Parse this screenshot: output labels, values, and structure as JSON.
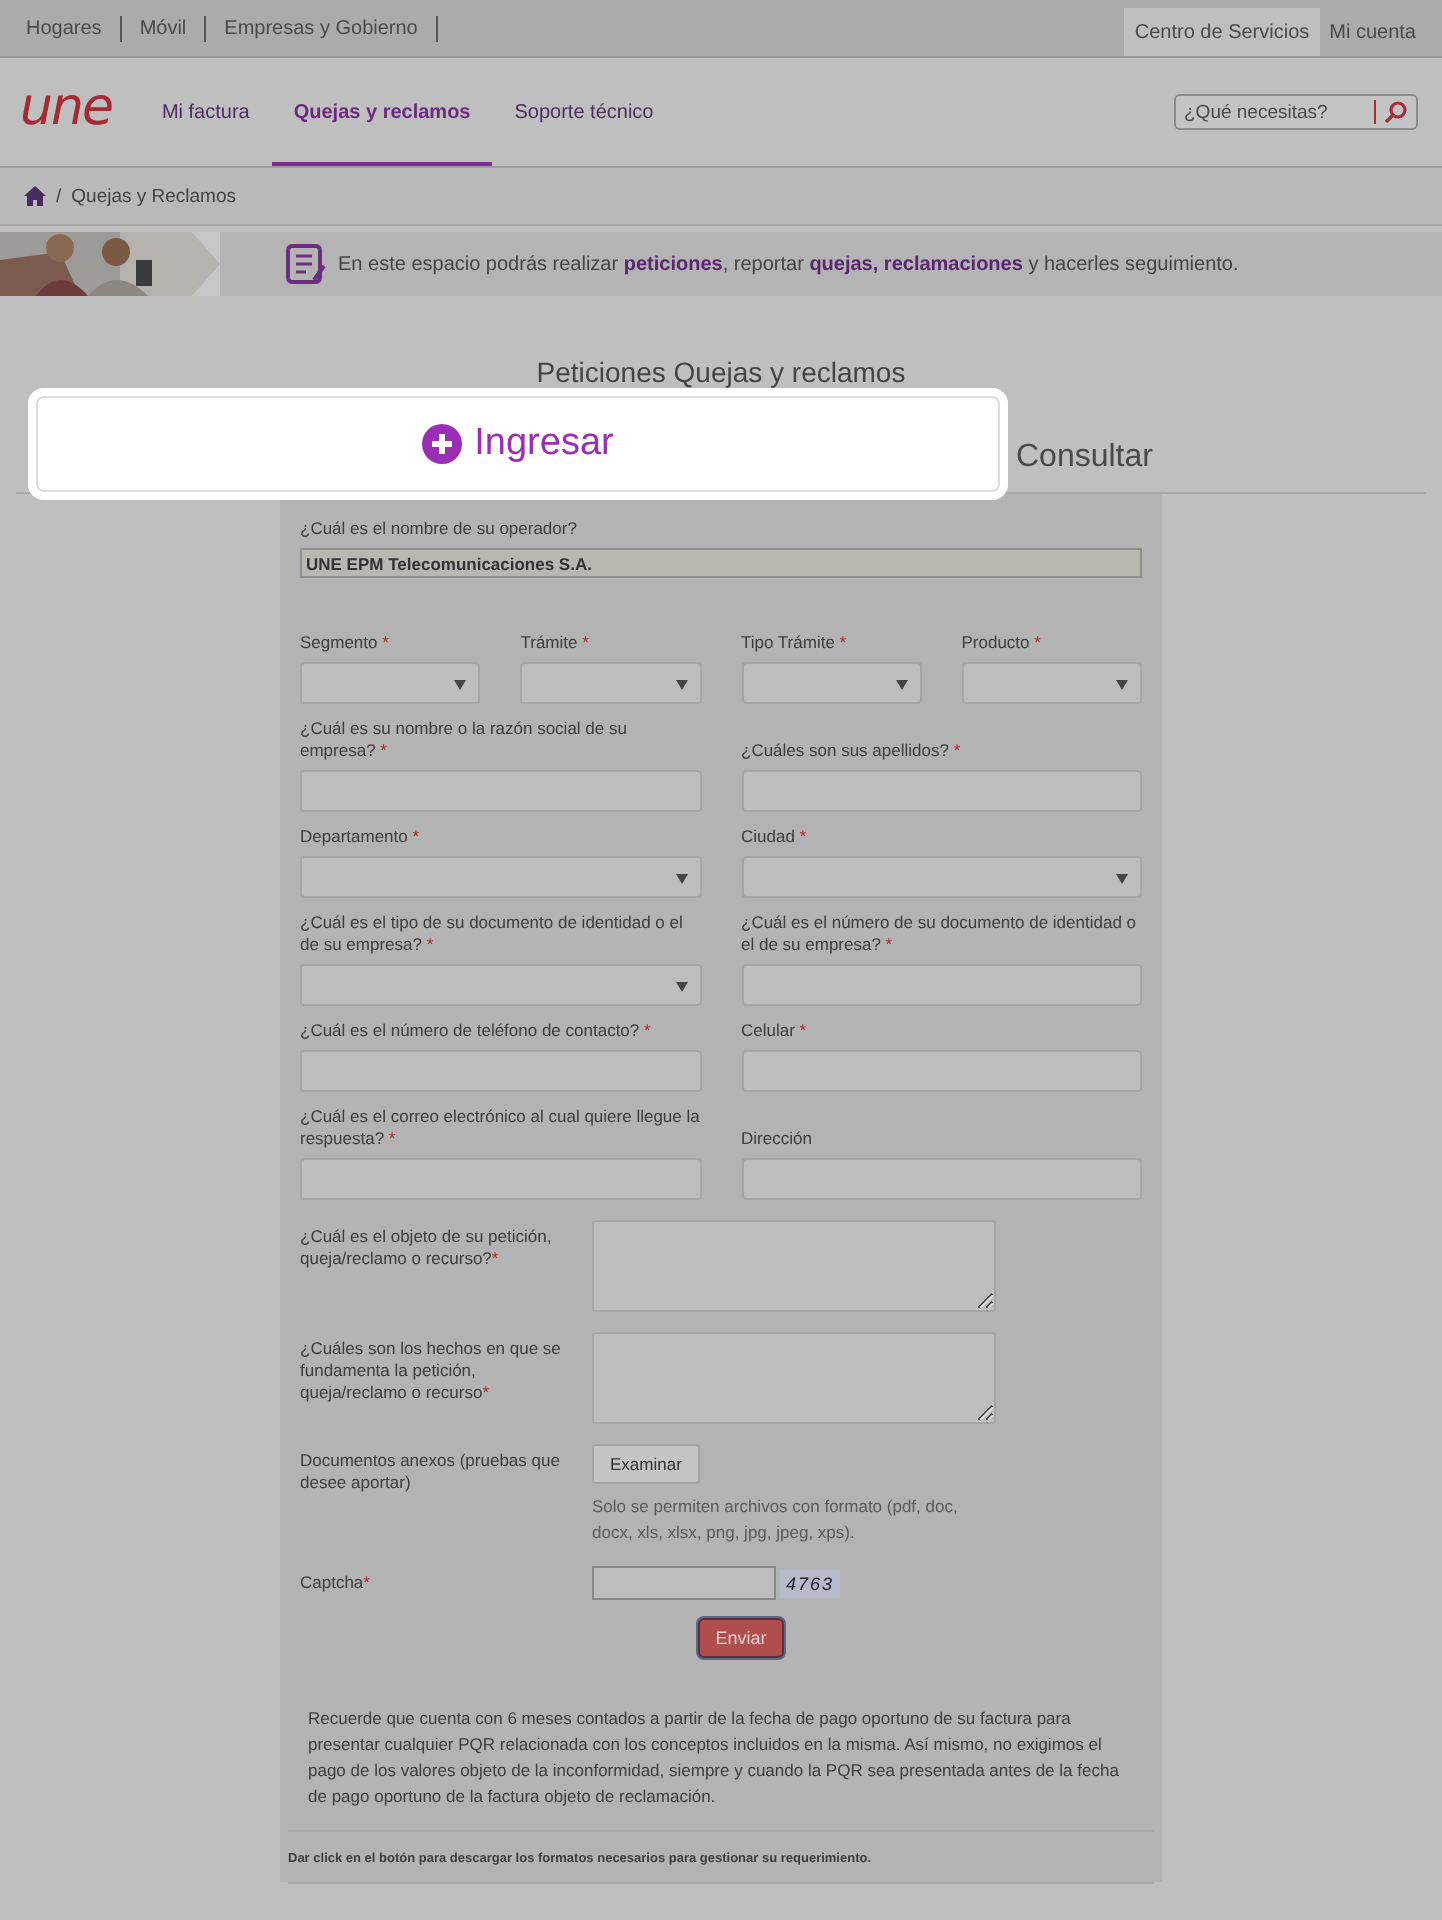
{
  "top_bar": {
    "links": [
      {
        "label": "Hogares"
      },
      {
        "label": "Móvil"
      },
      {
        "label": "Empresas y Gobierno"
      }
    ],
    "tabs": [
      {
        "label": "Centro de Servicios",
        "selected": true
      },
      {
        "label": "Mi cuenta",
        "selected": false
      }
    ]
  },
  "header": {
    "logo": "une",
    "nav": [
      {
        "label": "Mi factura",
        "selected": false
      },
      {
        "label": "Quejas y reclamos",
        "selected": true
      },
      {
        "label": "Soporte técnico",
        "selected": false
      }
    ],
    "search": {
      "placeholder": "¿Qué necesitas?"
    }
  },
  "breadcrumb": {
    "separator": "/",
    "current": "Quejas y Reclamos"
  },
  "banner": {
    "text": "En este espacio podrás realizar **peticiones**, reportar **quejas, reclamaciones** y hacerles seguimiento."
  },
  "page_title": "Peticiones Quejas y reclamos",
  "tabs": [
    {
      "label": "Ingresar",
      "selected": true
    },
    {
      "label": "Consultar",
      "selected": false
    }
  ],
  "form": {
    "operator": {
      "label": "¿Cuál es el nombre de su operador?",
      "value": "UNE EPM Telecomunicaciones S.A."
    },
    "selects": [
      {
        "label": "Segmento",
        "required_mark": "*"
      },
      {
        "label": "Trámite",
        "required_mark": "*"
      },
      {
        "label": "Tipo Trámite",
        "required_mark": "*"
      },
      {
        "label": "Producto",
        "required_mark": "*"
      }
    ],
    "fields": [
      {
        "label": "¿Cuál es su nombre o la razón social de su empresa?",
        "required_mark": "*",
        "kind": "text"
      },
      {
        "label": "¿Cuáles son sus apellidos?",
        "required_mark": "*",
        "kind": "text"
      },
      {
        "label": "Departamento",
        "required_mark": "*",
        "kind": "select"
      },
      {
        "label": "Ciudad",
        "required_mark": "*",
        "kind": "select"
      },
      {
        "label": "¿Cuál es el tipo de su documento de identidad o el de su empresa?",
        "required_mark": "*",
        "kind": "select"
      },
      {
        "label": "¿Cuál es el número de su documento de identidad o el de su empresa?",
        "required_mark": "*",
        "kind": "text"
      },
      {
        "label": "¿Cuál es el número de teléfono de contacto?",
        "required_mark": "*",
        "kind": "text"
      },
      {
        "label": "Celular",
        "required_mark": "*",
        "kind": "text"
      },
      {
        "label": "¿Cuál es el correo electrónico al cual quiere llegue la respuesta?",
        "required_mark": "*",
        "kind": "text"
      },
      {
        "label": "Dirección",
        "kind": "text"
      }
    ],
    "side_rows": [
      {
        "label": "¿Cuál es el objeto de su petición, queja/reclamo o recurso?",
        "required_mark": "*",
        "kind": "textarea"
      },
      {
        "label": "¿Cuáles son los hechos en que se fundamenta la petición, queja/reclamo o recurso",
        "required_mark": "*",
        "kind": "textarea"
      },
      {
        "label": "Documentos anexos (pruebas que desee aportar)",
        "kind": "file",
        "button": "Examinar",
        "note": "Solo se permiten archivos con formato (pdf, doc, docx, xls, xlsx, png, jpg, jpeg, xps)."
      },
      {
        "label": "Captcha",
        "required_mark": "*",
        "kind": "captcha",
        "captcha": "4763"
      }
    ],
    "submit": "Enviar",
    "notice": "Recuerde que cuenta con 6 meses contados a partir de la fecha de pago oportuno de su factura para presentar cualquier PQR relacionada con los conceptos incluidos en la misma. Así mismo, no exigimos el pago de los valores objeto de la inconformidad, siempre y cuando la PQR sea presentada antes de la fecha de pago oportuno de la factura objeto de reclamación.",
    "footer_note": "Dar click en el botón para descargar los formatos necesarios para gestionar su requerimiento."
  }
}
